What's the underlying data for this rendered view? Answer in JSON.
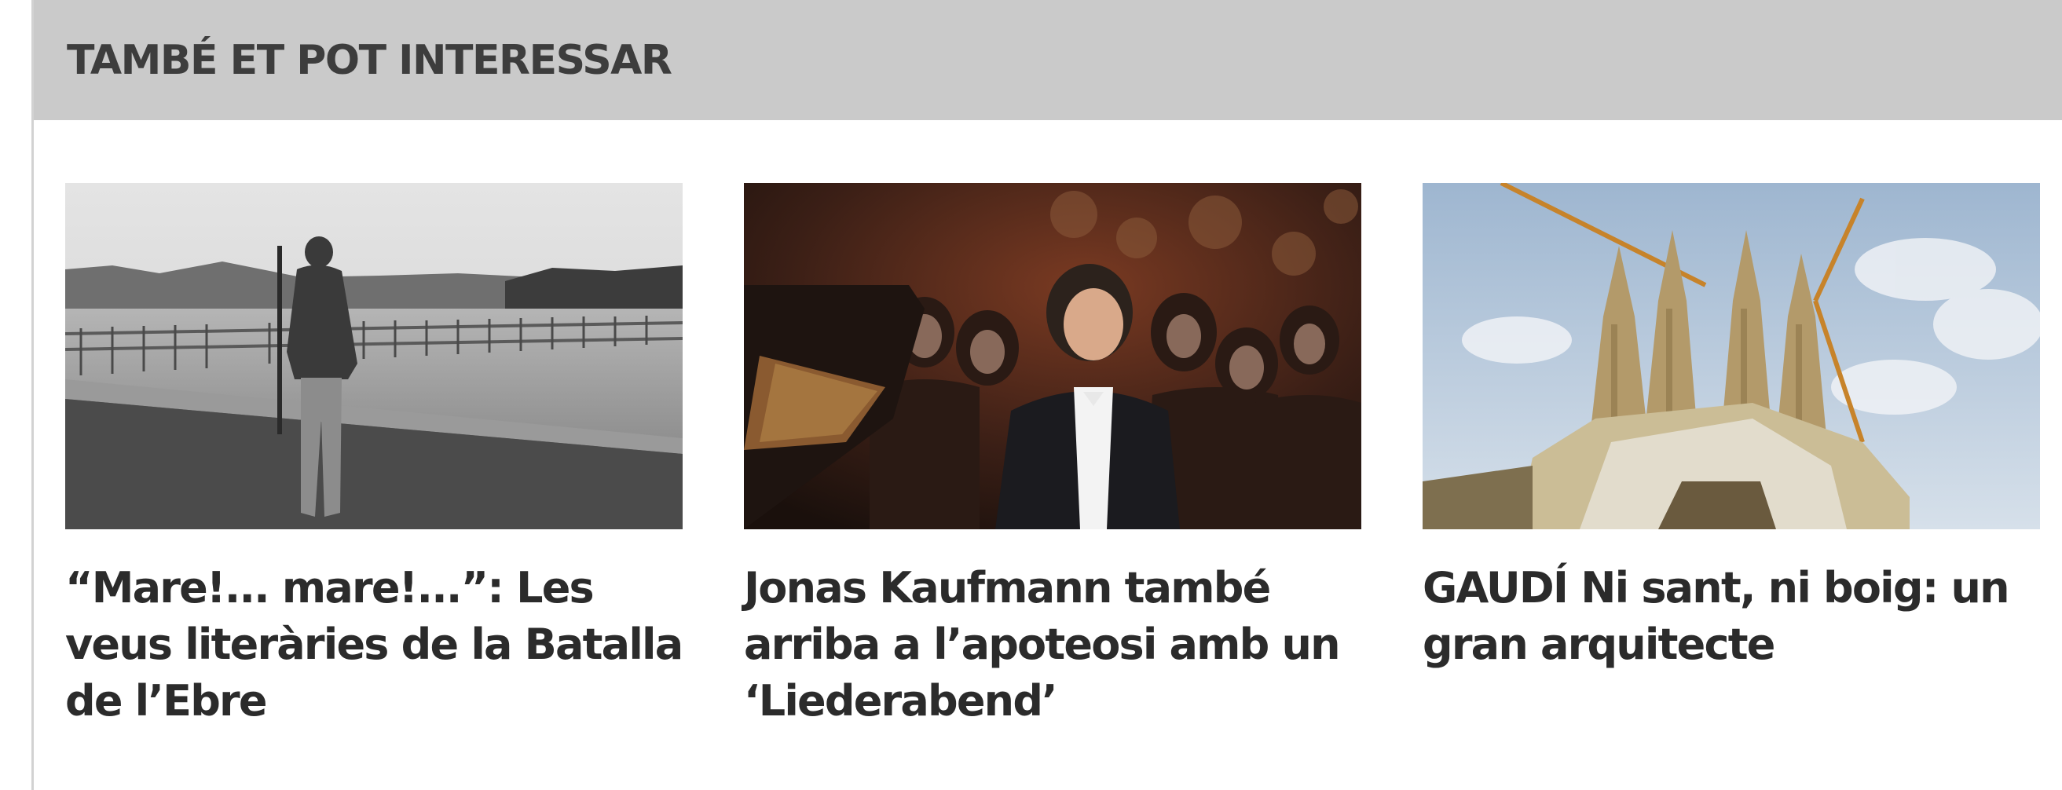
{
  "section": {
    "title": "TAMBÉ ET POT INTERESSAR"
  },
  "articles": [
    {
      "title": "“Mare!... mare!...”: Les veus literàries de la Batalla de l’Ebre",
      "image_icon": "soldier-river-photo"
    },
    {
      "title": "Jonas Kaufmann també arriba a l’apoteosi amb un ‘Liederabend’",
      "image_icon": "tenor-concert-photo"
    },
    {
      "title": "GAUDÍ Ni sant, ni boig: un gran arquitecte",
      "image_icon": "sagrada-familia-photo"
    }
  ]
}
